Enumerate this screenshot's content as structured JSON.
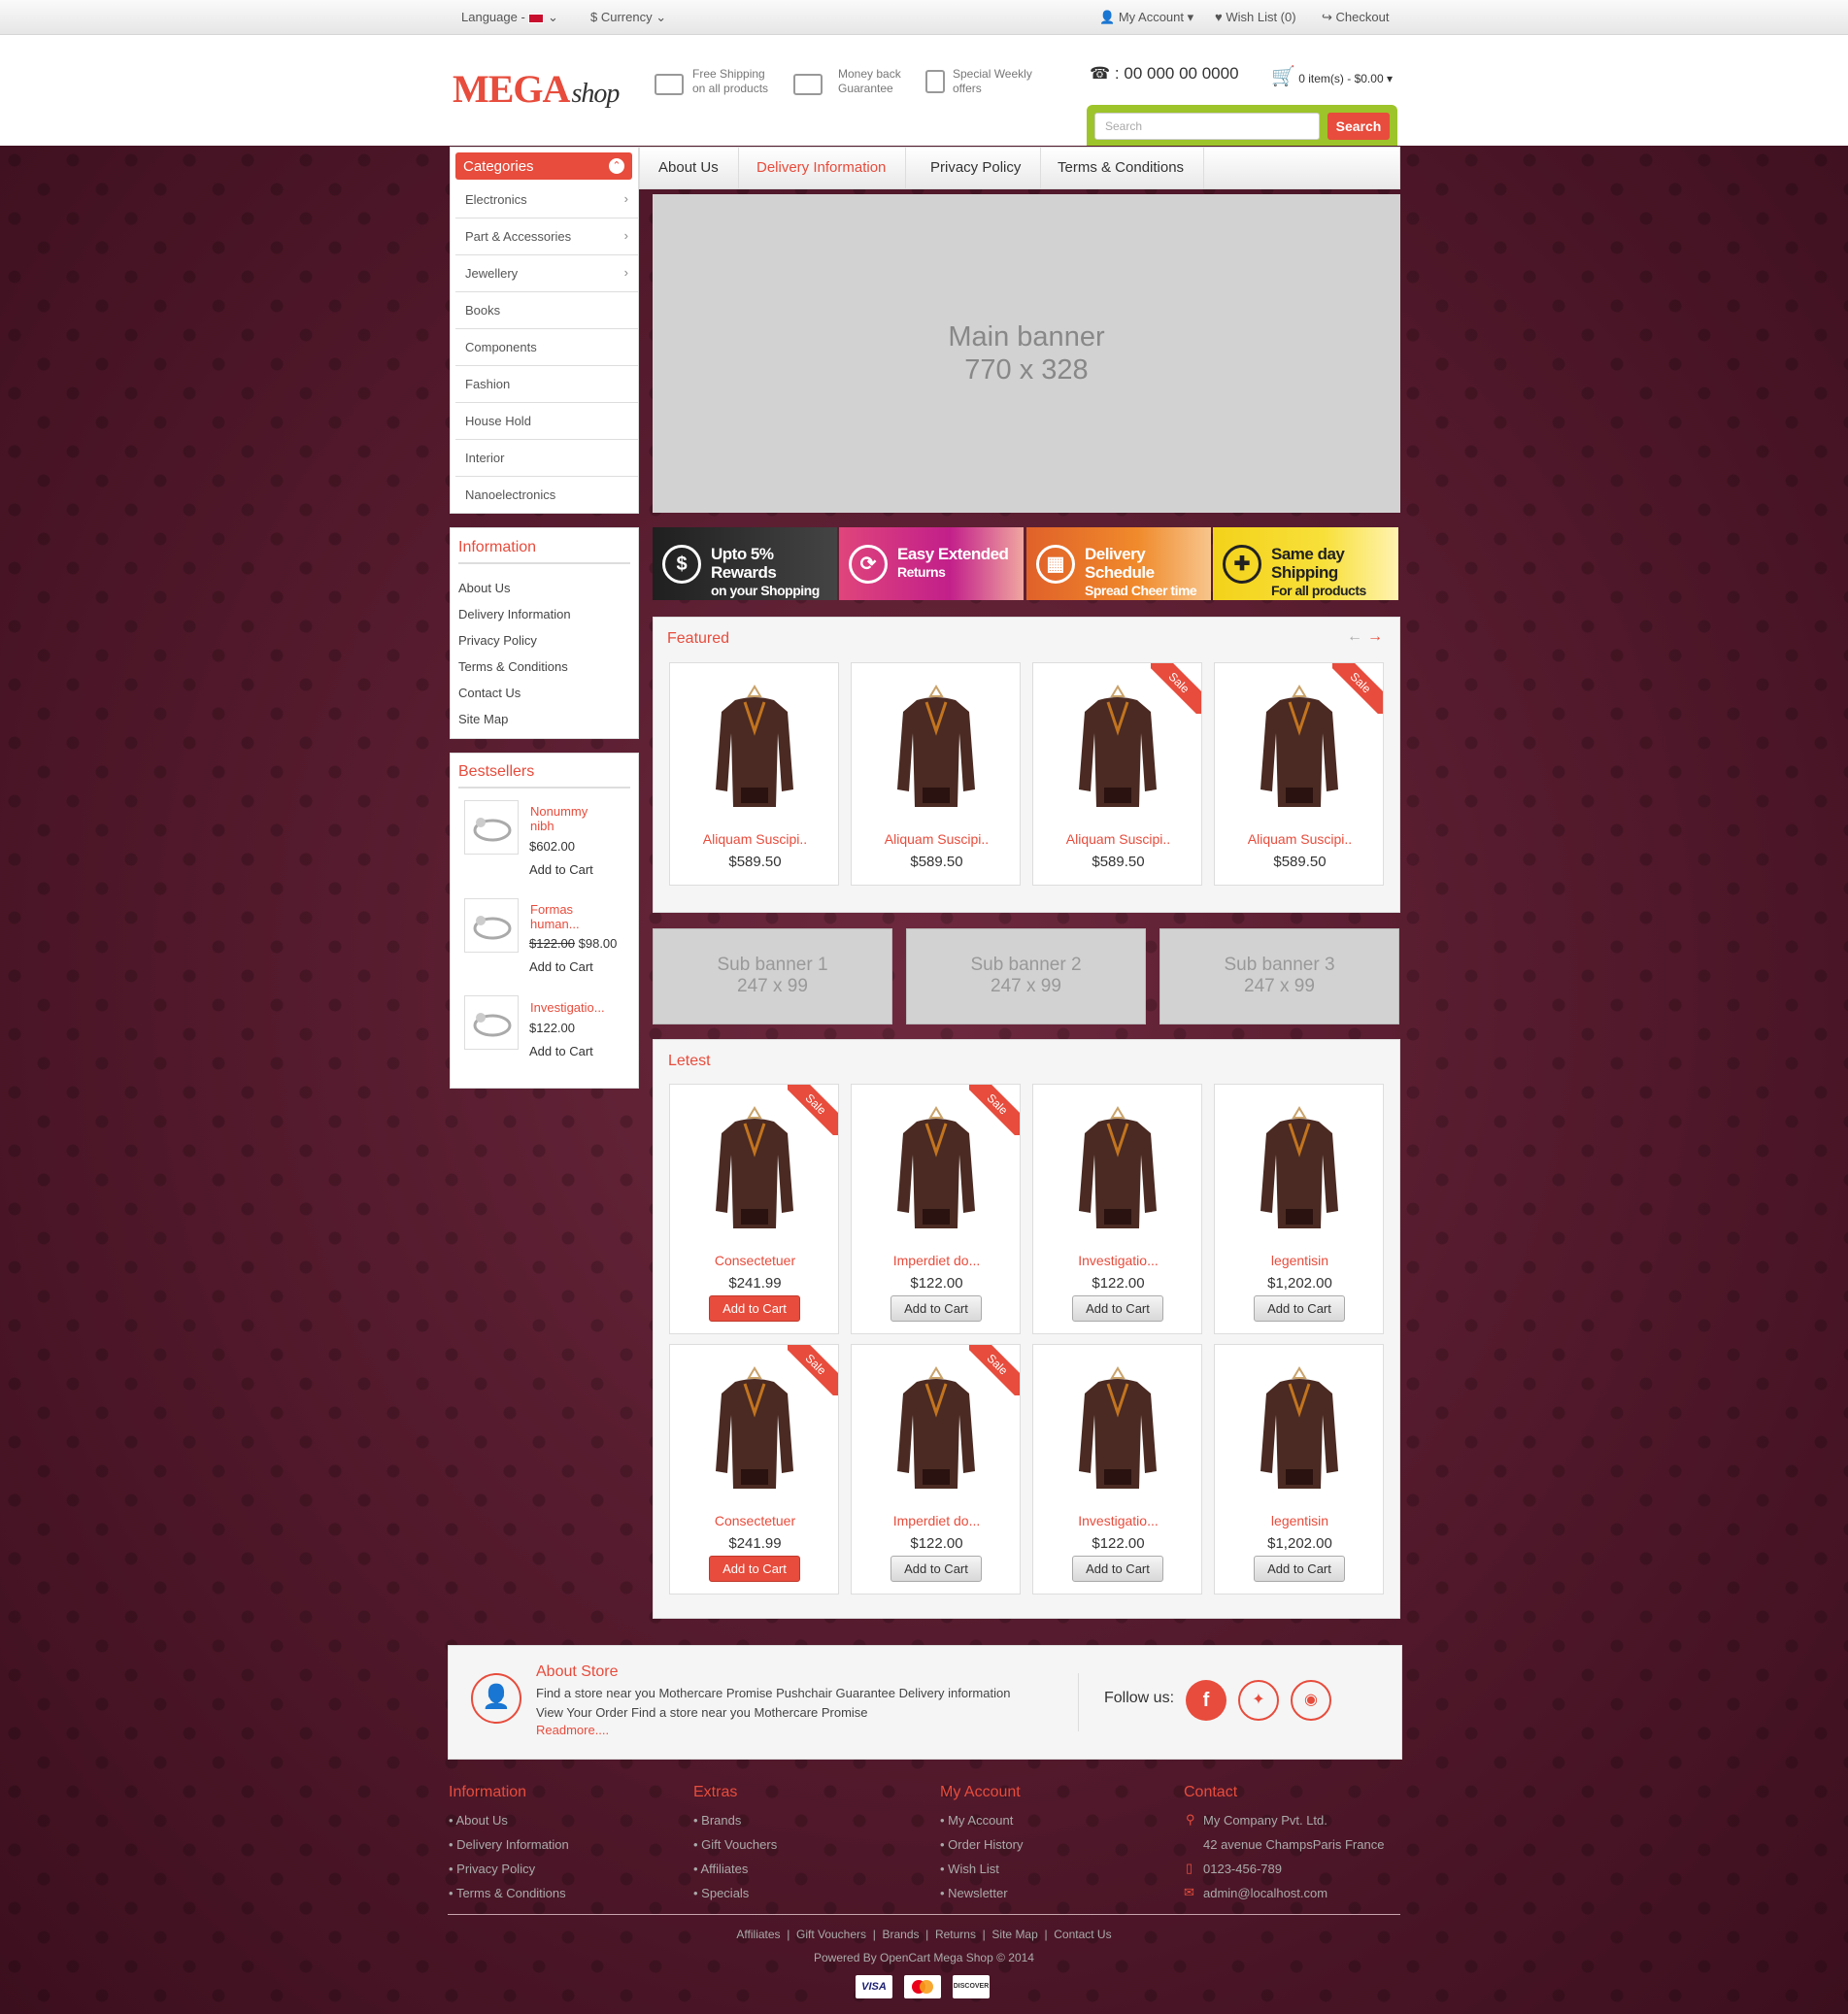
{
  "topbar": {
    "language_label": "Language -",
    "currency_label": "$ Currency",
    "my_account": "My Account",
    "wish_list": "Wish List (0)",
    "checkout": "Checkout"
  },
  "header": {
    "logo_main": "MEGA",
    "logo_sub": "shop",
    "features": [
      {
        "line1": "Free Shipping",
        "line2": "on all products"
      },
      {
        "line1": "Money back",
        "line2": "Guarantee"
      },
      {
        "line1": "Special Weekly",
        "line2": "offers"
      }
    ],
    "phone": ": 00 000 00 0000",
    "cart_summary": "0 item(s) - $0.00",
    "search_placeholder": "Search",
    "search_button": "Search"
  },
  "categories": {
    "title": "Categories",
    "items": [
      "Electronics",
      "Part & Accessories",
      "Jewellery",
      "Books",
      "Components",
      "Fashion",
      "House Hold",
      "Interior",
      "Nanoelectronics"
    ]
  },
  "nav": {
    "items": [
      "About Us",
      "Delivery Information",
      "Privacy Policy",
      "Terms & Conditions"
    ]
  },
  "main_banner": {
    "line1": "Main banner",
    "line2": "770 x 328"
  },
  "promos": [
    {
      "title": "Upto 5% Rewards",
      "sub": "on your Shopping",
      "icon": "$",
      "color": "#2b2b2b"
    },
    {
      "title": "Easy Extended",
      "sub": "Returns",
      "icon": "⟳",
      "color": "#e0457b"
    },
    {
      "title": "Delivery Schedule",
      "sub": "Spread Cheer time",
      "icon": "▦",
      "color": "#e8742a"
    },
    {
      "title": "Same day Shipping",
      "sub": "For all products",
      "icon": "✚",
      "color": "#f3d21a"
    }
  ],
  "information": {
    "title": "Information",
    "links": [
      "About Us",
      "Delivery Information",
      "Privacy Policy",
      "Terms & Conditions",
      "Contact Us",
      "Site Map"
    ]
  },
  "bestsellers": {
    "title": "Bestsellers",
    "items": [
      {
        "name": "Nonummy",
        "name2": "nibh",
        "price": "$602.00",
        "old": "",
        "cta": "Add to Cart"
      },
      {
        "name": "Formas",
        "name2": "human...",
        "price": "$98.00",
        "old": "$122.00",
        "cta": "Add to Cart"
      },
      {
        "name": "Investigatio...",
        "name2": "",
        "price": "$122.00",
        "old": "",
        "cta": "Add to Cart"
      }
    ]
  },
  "featured": {
    "title": "Featured",
    "items": [
      {
        "name": "Aliquam Suscipi..",
        "price": "$589.50",
        "sale": false
      },
      {
        "name": "Aliquam Suscipi..",
        "price": "$589.50",
        "sale": false
      },
      {
        "name": "Aliquam Suscipi..",
        "price": "$589.50",
        "sale": true
      },
      {
        "name": "Aliquam Suscipi..",
        "price": "$589.50",
        "sale": true
      }
    ]
  },
  "sub_banners": [
    {
      "line1": "Sub banner 1",
      "line2": "247 x 99"
    },
    {
      "line1": "Sub banner 2",
      "line2": "247 x 99"
    },
    {
      "line1": "Sub banner 3",
      "line2": "247 x 99"
    }
  ],
  "latest": {
    "title": "Letest",
    "cta": "Add to Cart",
    "items": [
      {
        "name": "Consectetuer",
        "price": "$241.99",
        "sale": true
      },
      {
        "name": "Imperdiet do...",
        "price": "$122.00",
        "sale": true
      },
      {
        "name": "Investigatio...",
        "price": "$122.00",
        "sale": false
      },
      {
        "name": "legentisin",
        "price": "$1,202.00",
        "sale": false
      },
      {
        "name": "Consectetuer",
        "price": "$241.99",
        "sale": true
      },
      {
        "name": "Imperdiet do...",
        "price": "$122.00",
        "sale": true
      },
      {
        "name": "Investigatio...",
        "price": "$122.00",
        "sale": false
      },
      {
        "name": "legentisin",
        "price": "$1,202.00",
        "sale": false
      }
    ]
  },
  "sale_label": "Sale",
  "about_store": {
    "title": "About Store",
    "line1": "Find a store near you Mothercare Promise Pushchair Guarantee Delivery information",
    "line2": "View Your Order Find a store near you Mothercare Promise",
    "readmore": "Readmore....",
    "follow": "Follow us:"
  },
  "footer": {
    "information": {
      "title": "Information",
      "links": [
        "About Us",
        "Delivery Information",
        "Privacy Policy",
        "Terms & Conditions"
      ]
    },
    "extras": {
      "title": "Extras",
      "links": [
        "Brands",
        "Gift Vouchers",
        "Affiliates",
        "Specials"
      ]
    },
    "my_account": {
      "title": "My Account",
      "links": [
        "My Account",
        "Order History",
        "Wish List",
        "Newsletter"
      ]
    },
    "contact": {
      "title": "Contact",
      "company": "My Company Pvt. Ltd.",
      "address": "42 avenue ChampsParis France",
      "phone": "0123-456-789",
      "email": "admin@localhost.com"
    },
    "bottom_links": "Affiliates  |  Gift Vouchers  |  Brands  |  Returns  |  Site Map  |  Contact Us",
    "powered": "Powered By OpenCart Mega Shop © 2014",
    "cards": [
      "VISA",
      "MC",
      "DISCOVER"
    ]
  },
  "colors": {
    "accent": "#e74c3c",
    "search_green": "#9dc42a",
    "background": "#561b2e"
  }
}
